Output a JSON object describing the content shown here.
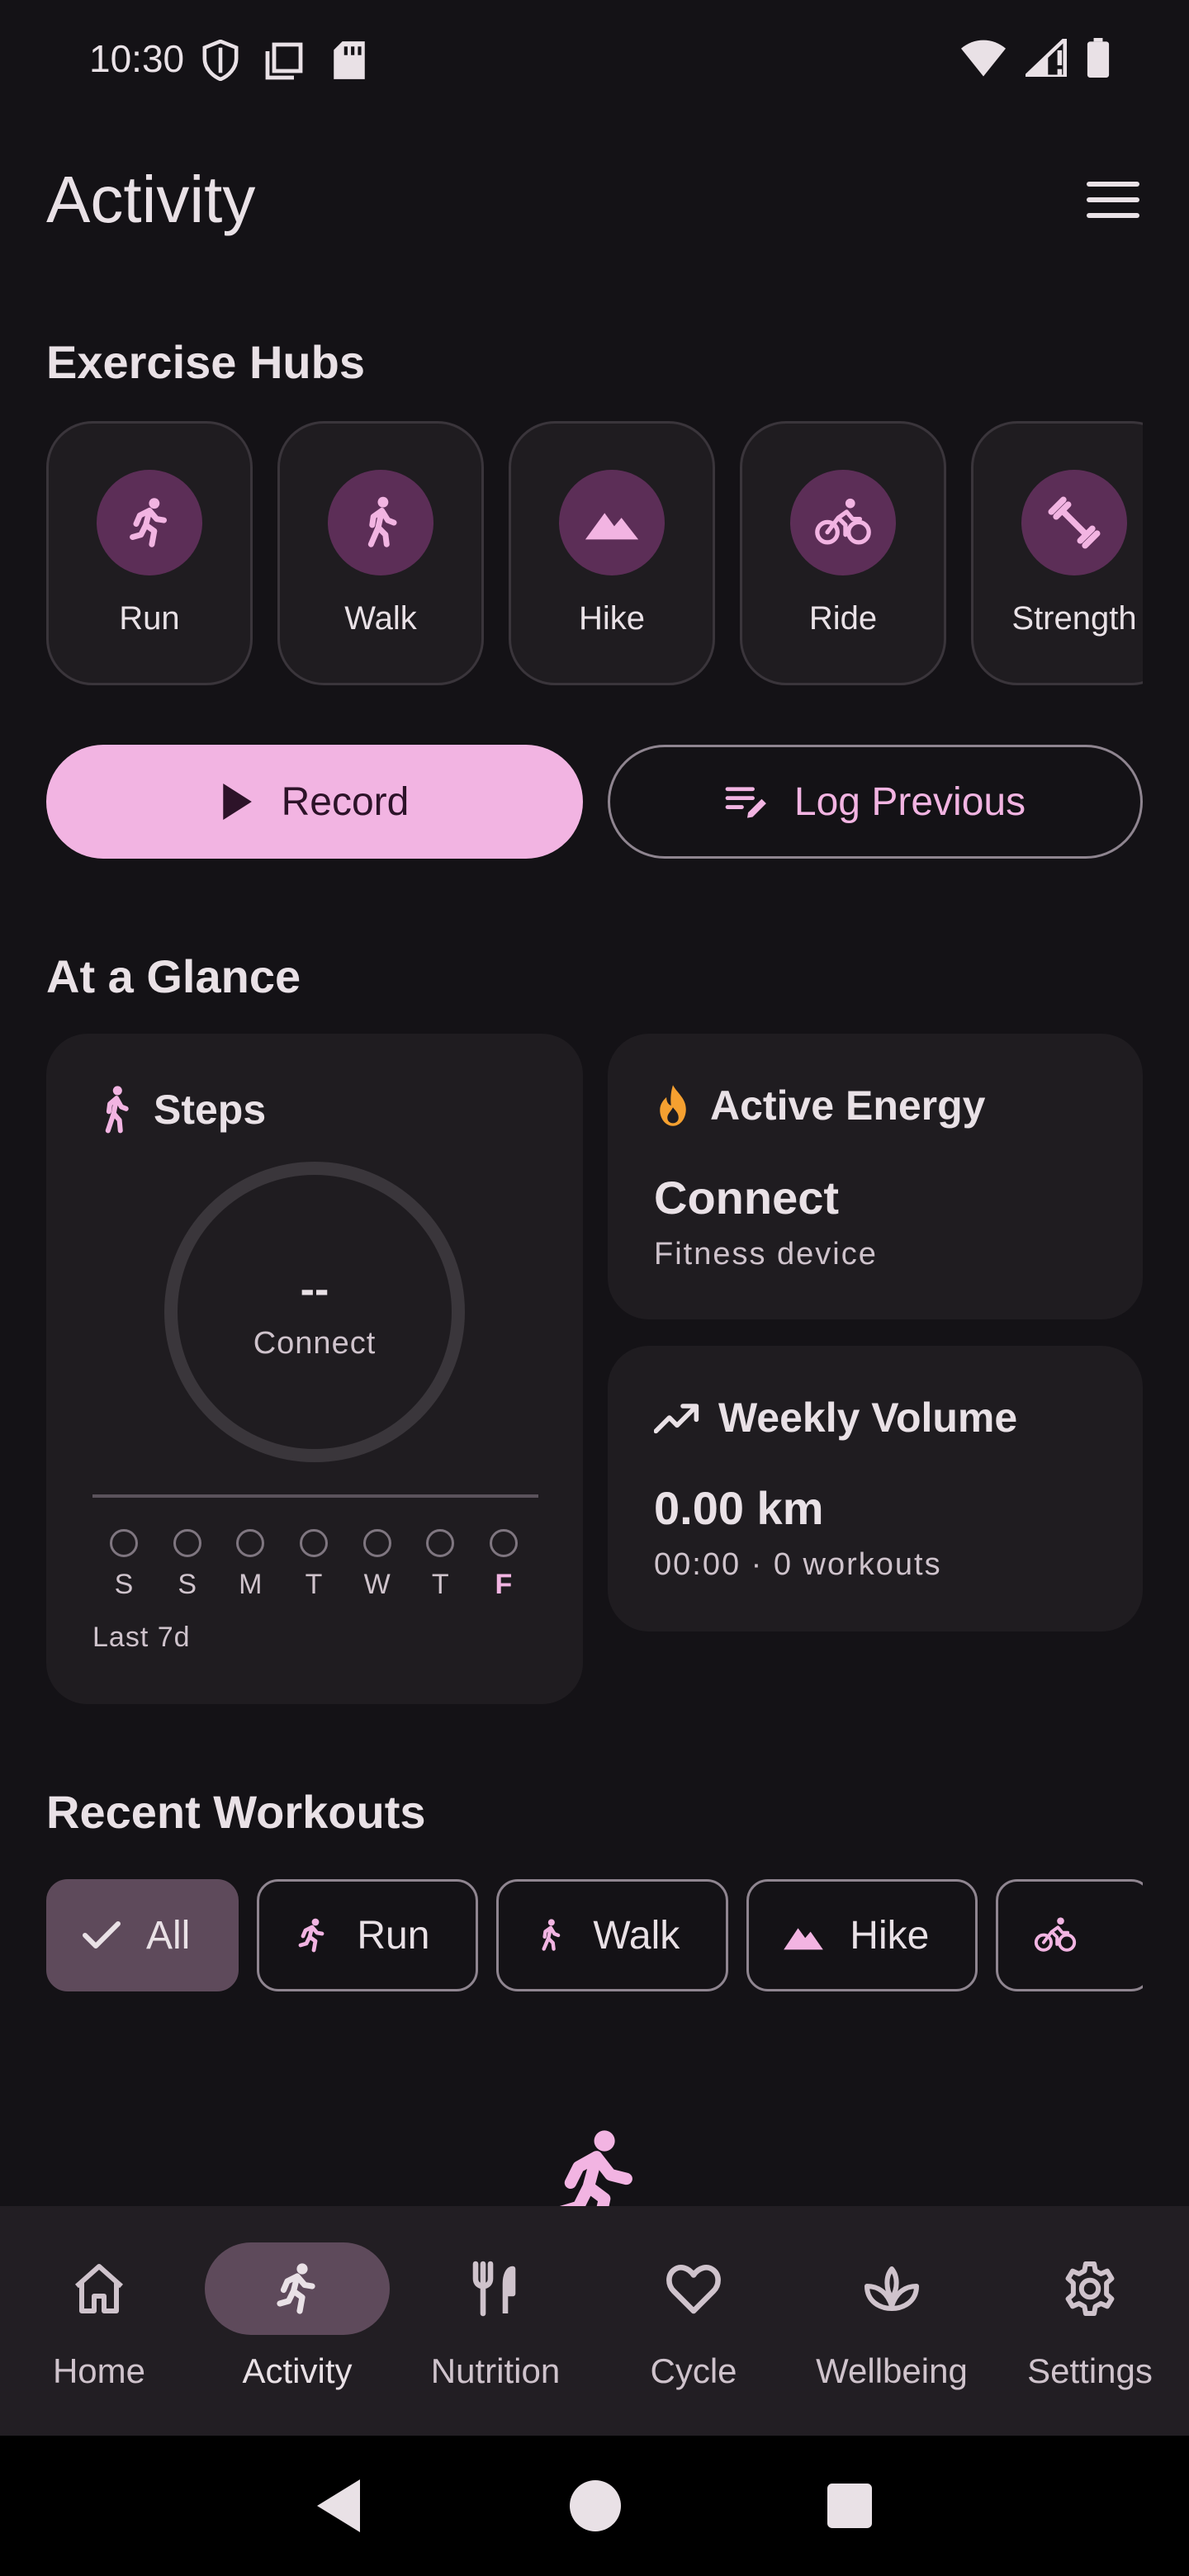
{
  "status_bar": {
    "time": "10:30",
    "icons_left": [
      "shield-icon",
      "sim-tray-icon",
      "sd-card-icon"
    ],
    "icons_right": [
      "wifi-icon",
      "cell-signal-icon",
      "battery-icon"
    ]
  },
  "header": {
    "title": "Activity",
    "menu_icon": "hamburger-menu-icon"
  },
  "hubs": {
    "title": "Exercise Hubs",
    "items": [
      {
        "label": "Run",
        "icon": "run-icon"
      },
      {
        "label": "Walk",
        "icon": "walk-icon"
      },
      {
        "label": "Hike",
        "icon": "mountain-icon"
      },
      {
        "label": "Ride",
        "icon": "bike-icon"
      },
      {
        "label": "Strength",
        "icon": "dumbbell-icon"
      }
    ]
  },
  "actions": {
    "record_label": "Record",
    "log_previous_label": "Log Previous"
  },
  "glance": {
    "title": "At a Glance",
    "steps": {
      "title": "Steps",
      "value": "--",
      "sub": "Connect",
      "days": [
        "S",
        "S",
        "M",
        "T",
        "W",
        "T",
        "F"
      ],
      "today_index": 6,
      "footer": "Last 7d"
    },
    "active_energy": {
      "title": "Active Energy",
      "value": "Connect",
      "sub": "Fitness device"
    },
    "weekly_volume": {
      "title": "Weekly Volume",
      "value": "0.00 km",
      "sub": "00:00 · 0 workouts"
    }
  },
  "recent": {
    "title": "Recent Workouts",
    "filters": [
      {
        "label": "All",
        "selected": true
      },
      {
        "label": "Run",
        "selected": false
      },
      {
        "label": "Walk",
        "selected": false
      },
      {
        "label": "Hike",
        "selected": false
      },
      {
        "label": "",
        "selected": false
      }
    ]
  },
  "bottom_nav": {
    "items": [
      {
        "label": "Home",
        "icon": "home-icon",
        "active": false
      },
      {
        "label": "Activity",
        "icon": "run-icon",
        "active": true
      },
      {
        "label": "Nutrition",
        "icon": "fork-knife-icon",
        "active": false
      },
      {
        "label": "Cycle",
        "icon": "heart-icon",
        "active": false
      },
      {
        "label": "Wellbeing",
        "icon": "lotus-icon",
        "active": false
      },
      {
        "label": "Settings",
        "icon": "gear-icon",
        "active": false
      }
    ]
  },
  "colors": {
    "background": "#141216",
    "card": "#1F1C20",
    "accent": "#F2B4E2",
    "hub_circle": "#5C2E57",
    "energy_flame": "#F5A030",
    "selected_chip": "#5E4A5B"
  }
}
